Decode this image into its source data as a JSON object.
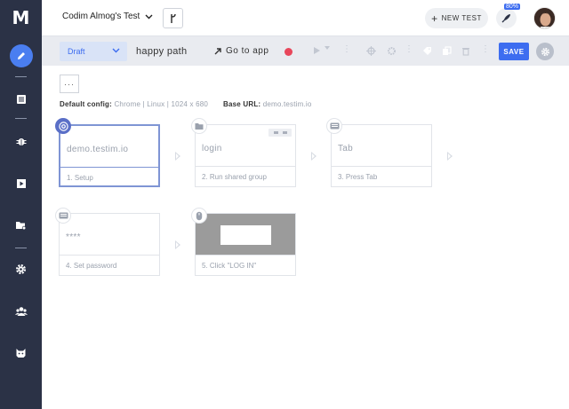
{
  "app": {
    "logo": "M"
  },
  "topbar": {
    "project_name": "Codim Almog's Test",
    "new_test_label": "NEW TEST",
    "usage_badge": "80%"
  },
  "toolbar": {
    "status": "Draft",
    "test_name": "happy path",
    "goto_label": "Go to app",
    "save_label": "SAVE"
  },
  "main": {
    "more_label": "···",
    "config_label": "Default config:",
    "config_value": "Chrome | Linux | 1024 x 680",
    "base_url_label": "Base URL:",
    "base_url_value": "demo.testim.io"
  },
  "steps": [
    {
      "title": "demo.testim.io",
      "label": "1. Setup",
      "icon": "chrome-icon"
    },
    {
      "title": "login",
      "label": "2. Run shared group",
      "icon": "folder-icon"
    },
    {
      "title": "Tab",
      "label": "3. Press Tab",
      "icon": "keyboard-icon"
    },
    {
      "title": "****",
      "label": "4. Set password",
      "icon": "keyboard-icon"
    },
    {
      "title": "",
      "label": "5. Click \"LOG IN\"",
      "icon": "mouse-icon"
    }
  ],
  "colors": {
    "sidebar_bg": "#2b3246",
    "accent": "#3d6df0",
    "record": "#e8465b",
    "selected_border": "#7f95d4"
  }
}
